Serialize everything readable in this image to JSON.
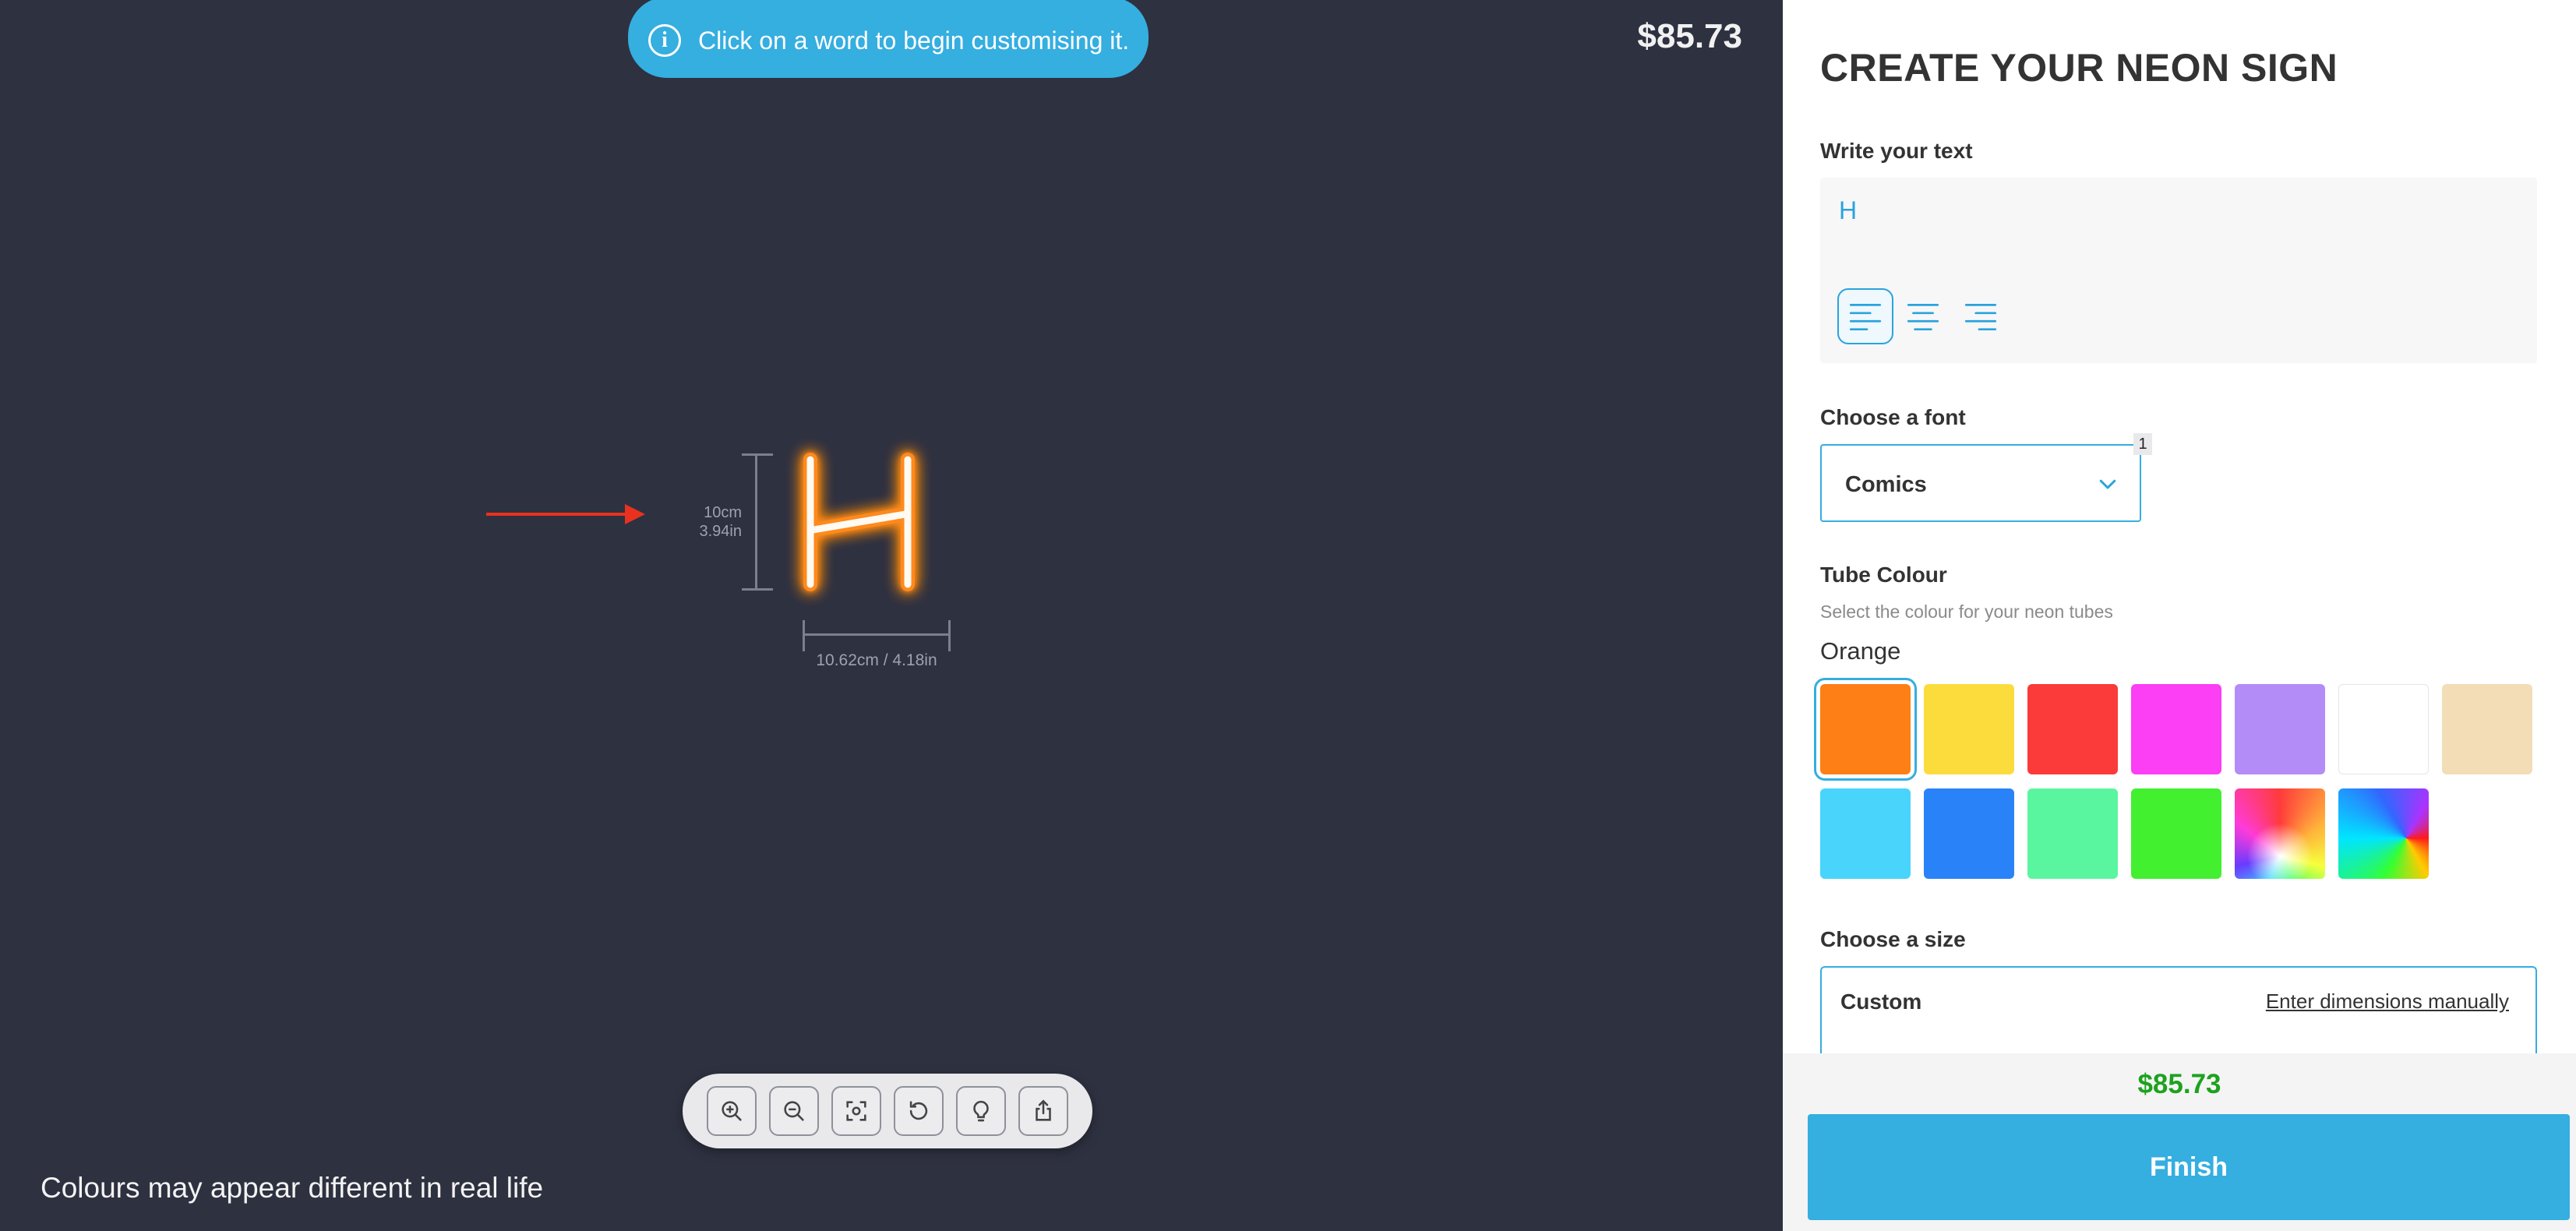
{
  "canvas": {
    "banner_text": "Click on a word to begin customising it.",
    "price": "$85.73",
    "height_label_cm": "10cm",
    "height_label_in": "3.94in",
    "width_label": "10.62cm / 4.18in",
    "sign_letter": "H",
    "disclaimer": "Colours may appear different in real life",
    "toolbar": [
      {
        "name": "zoom-in-icon"
      },
      {
        "name": "zoom-out-icon"
      },
      {
        "name": "fit-screen-icon"
      },
      {
        "name": "reset-icon"
      },
      {
        "name": "lightbulb-icon"
      },
      {
        "name": "share-icon"
      }
    ]
  },
  "panel": {
    "title": "CREATE YOUR NEON SIGN",
    "text_section": {
      "label": "Write your text",
      "value": "H",
      "alignments": [
        "align-left",
        "align-center",
        "align-right"
      ],
      "active_alignment": "align-left"
    },
    "font_section": {
      "label": "Choose a font",
      "selected": "Comics",
      "badge": "1"
    },
    "colour_section": {
      "label": "Tube Colour",
      "subtitle": "Select the colour for your neon tubes",
      "selected_name": "Orange",
      "swatches": [
        {
          "color": "#fd7f16",
          "selected": true
        },
        {
          "color": "#fcdc3d"
        },
        {
          "color": "#fb3a3a"
        },
        {
          "color": "#fc3ef5"
        },
        {
          "color": "#b48cf7"
        },
        {
          "color": "#ffffff"
        },
        {
          "color": "#f3ddb7"
        },
        {
          "color": "#48d4fb"
        },
        {
          "color": "#2a82f9"
        },
        {
          "color": "#5af69f"
        },
        {
          "color": "#42f030"
        },
        {
          "color": "rainbow"
        },
        {
          "color": "rgb-gradient"
        }
      ]
    },
    "size_section": {
      "label": "Choose a size",
      "option_name": "Custom",
      "option_link": "Enter dimensions manually"
    },
    "footer": {
      "price": "$85.73",
      "finish_label": "Finish"
    },
    "accent_color": "#35aee0",
    "price_color": "#1da21d"
  }
}
